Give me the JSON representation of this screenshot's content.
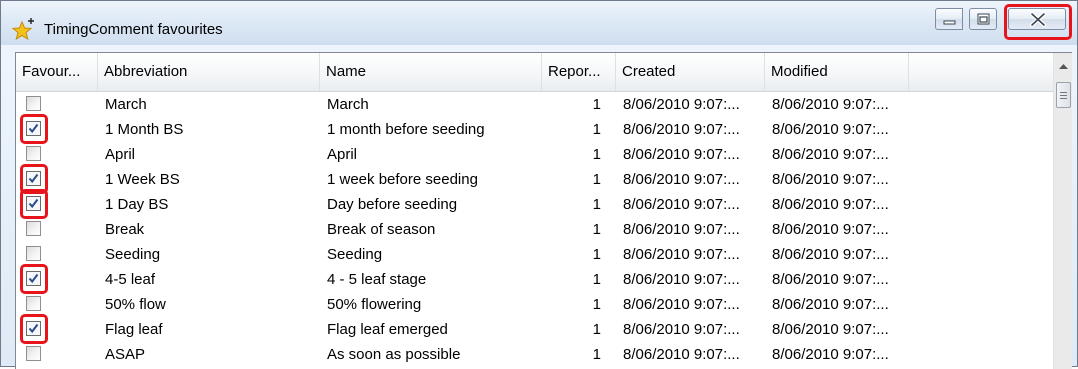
{
  "window": {
    "title": "TimingComment favourites",
    "title_icon": "star-plus-icon",
    "buttons": [
      "minimize-icon",
      "maximize-icon",
      "close-icon"
    ]
  },
  "table": {
    "columns": [
      "Favour...",
      "Abbreviation",
      "Name",
      "Repor...",
      "Created",
      "Modified"
    ],
    "rows": [
      {
        "checked": false,
        "abbreviation": "March",
        "name": "March",
        "report": "1",
        "created": "8/06/2010 9:07:...",
        "modified": "8/06/2010 9:07:..."
      },
      {
        "checked": true,
        "abbreviation": "1 Month BS",
        "name": "1 month before seeding",
        "report": "1",
        "created": "8/06/2010 9:07:...",
        "modified": "8/06/2010 9:07:..."
      },
      {
        "checked": false,
        "abbreviation": "April",
        "name": "April",
        "report": "1",
        "created": "8/06/2010 9:07:...",
        "modified": "8/06/2010 9:07:..."
      },
      {
        "checked": true,
        "abbreviation": "1 Week BS",
        "name": "1 week before seeding",
        "report": "1",
        "created": "8/06/2010 9:07:...",
        "modified": "8/06/2010 9:07:..."
      },
      {
        "checked": true,
        "abbreviation": "1 Day BS",
        "name": "Day before seeding",
        "report": "1",
        "created": "8/06/2010 9:07:...",
        "modified": "8/06/2010 9:07:..."
      },
      {
        "checked": false,
        "abbreviation": "Break",
        "name": "Break of season",
        "report": "1",
        "created": "8/06/2010 9:07:...",
        "modified": "8/06/2010 9:07:..."
      },
      {
        "checked": false,
        "abbreviation": "Seeding",
        "name": "Seeding",
        "report": "1",
        "created": "8/06/2010 9:07:...",
        "modified": "8/06/2010 9:07:..."
      },
      {
        "checked": true,
        "abbreviation": "4-5 leaf",
        "name": "4 - 5 leaf stage",
        "report": "1",
        "created": "8/06/2010 9:07:...",
        "modified": "8/06/2010 9:07:..."
      },
      {
        "checked": false,
        "abbreviation": "50% flow",
        "name": "50% flowering",
        "report": "1",
        "created": "8/06/2010 9:07:...",
        "modified": "8/06/2010 9:07:..."
      },
      {
        "checked": true,
        "abbreviation": "Flag leaf",
        "name": "Flag leaf emerged",
        "report": "1",
        "created": "8/06/2010 9:07:...",
        "modified": "8/06/2010 9:07:..."
      },
      {
        "checked": false,
        "abbreviation": "ASAP",
        "name": "As soon as possible",
        "report": "1",
        "created": "8/06/2010 9:07:...",
        "modified": "8/06/2010 9:07:..."
      }
    ]
  },
  "annotations": {
    "highlight_color": "#e8141c",
    "highlighted": [
      "close-button",
      "checked-favourite-checkboxes"
    ]
  },
  "colors": {
    "titlebar": "#dbe7f4",
    "grid_border": "#828790"
  }
}
